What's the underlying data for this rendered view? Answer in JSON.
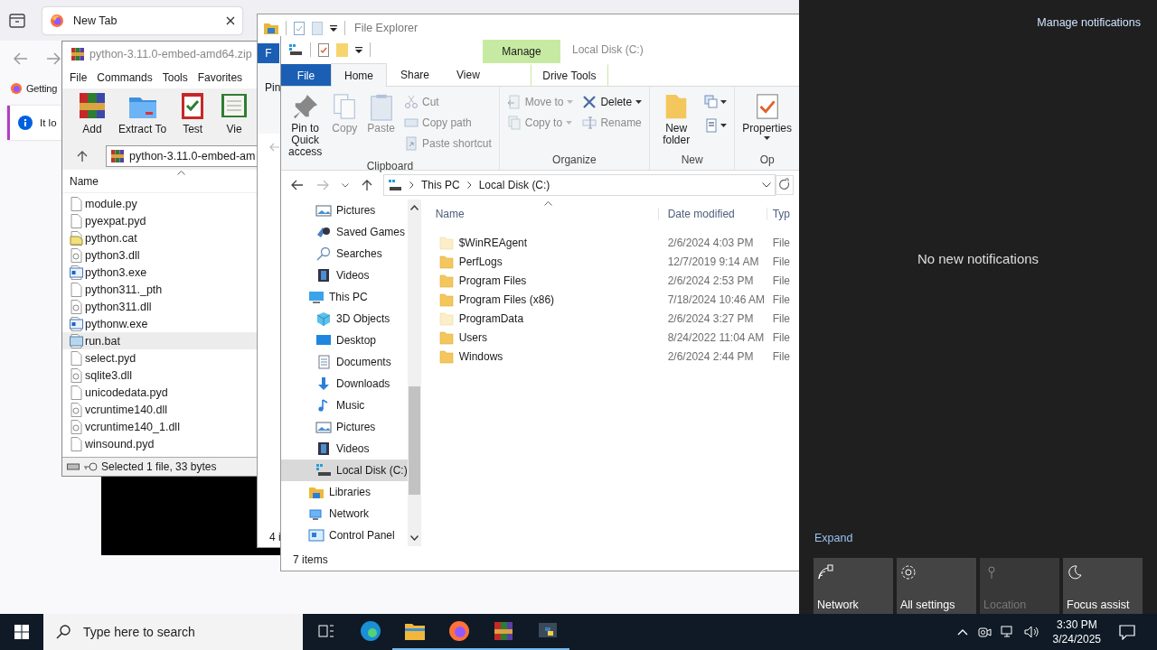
{
  "browser": {
    "tab_title": "New Tab",
    "bookmark": "Getting",
    "notice": "It lo"
  },
  "archiver": {
    "title": "python-3.11.0-embed-amd64.zip",
    "menu": [
      "File",
      "Commands",
      "Tools",
      "Favorites"
    ],
    "tools": [
      {
        "label": "Add",
        "kind": "add"
      },
      {
        "label": "Extract To",
        "kind": "extract"
      },
      {
        "label": "Test",
        "kind": "test"
      },
      {
        "label": "Vie",
        "kind": "view"
      }
    ],
    "path": "python-3.11.0-embed-am",
    "column": "Name",
    "files": [
      {
        "name": "module.py",
        "kind": "blank",
        "selected": false
      },
      {
        "name": "pyexpat.pyd",
        "kind": "blank",
        "selected": false
      },
      {
        "name": "python.cat",
        "kind": "cat",
        "selected": false
      },
      {
        "name": "python3.dll",
        "kind": "dll",
        "selected": false
      },
      {
        "name": "python3.exe",
        "kind": "exe",
        "selected": false
      },
      {
        "name": "python311._pth",
        "kind": "blank",
        "selected": false
      },
      {
        "name": "python311.dll",
        "kind": "dll",
        "selected": false
      },
      {
        "name": "pythonw.exe",
        "kind": "exe",
        "selected": false
      },
      {
        "name": "run.bat",
        "kind": "bat",
        "selected": true
      },
      {
        "name": "select.pyd",
        "kind": "blank",
        "selected": false
      },
      {
        "name": "sqlite3.dll",
        "kind": "dll",
        "selected": false
      },
      {
        "name": "unicodedata.pyd",
        "kind": "blank",
        "selected": false
      },
      {
        "name": "vcruntime140.dll",
        "kind": "dll",
        "selected": false
      },
      {
        "name": "vcruntime140_1.dll",
        "kind": "dll",
        "selected": false
      },
      {
        "name": "winsound.pyd",
        "kind": "blank",
        "selected": false
      }
    ],
    "status": "Selected 1 file, 33 bytes"
  },
  "explorer_back": {
    "title": "File Explorer",
    "tab": "F",
    "command": "Pin",
    "status": "4 i"
  },
  "explorer": {
    "title": "Local Disk (C:)",
    "context_group": "Manage",
    "tabs": [
      {
        "label": "File",
        "kind": "file",
        "selected": false
      },
      {
        "label": "Home",
        "kind": "tab",
        "selected": true
      },
      {
        "label": "Share",
        "kind": "tab",
        "selected": false
      },
      {
        "label": "View",
        "kind": "tab",
        "selected": false
      },
      {
        "label": "Drive Tools",
        "kind": "context",
        "selected": false
      }
    ],
    "groups": [
      {
        "label": "Clipboard",
        "columns": [
          [
            {
              "label": "Pin to Quick access",
              "kind": "large",
              "disabled": false,
              "menu": false
            }
          ],
          [
            {
              "label": "Copy",
              "kind": "large",
              "disabled": true,
              "menu": false
            }
          ],
          [
            {
              "label": "Paste",
              "kind": "large",
              "disabled": true,
              "menu": false
            }
          ],
          [
            {
              "label": "Cut",
              "kind": "small",
              "disabled": true,
              "menu": false
            },
            {
              "label": "Copy path",
              "kind": "small",
              "disabled": true,
              "menu": false
            },
            {
              "label": "Paste shortcut",
              "kind": "small",
              "disabled": true,
              "menu": false
            }
          ]
        ]
      },
      {
        "label": "Organize",
        "columns": [
          [
            {
              "label": "Move to",
              "kind": "small",
              "disabled": true,
              "menu": true
            },
            {
              "label": "Copy to",
              "kind": "small",
              "disabled": true,
              "menu": true
            }
          ],
          [
            {
              "label": "Delete",
              "kind": "small",
              "disabled": false,
              "menu": true
            },
            {
              "label": "Rename",
              "kind": "small",
              "disabled": true,
              "menu": false
            }
          ]
        ]
      },
      {
        "label": "New",
        "columns": [
          [
            {
              "label": "New folder",
              "kind": "large",
              "disabled": false,
              "menu": false
            }
          ],
          [
            {
              "kind": "icon",
              "disabled": false,
              "menu": true
            },
            {
              "kind": "icon",
              "disabled": false,
              "menu": true
            }
          ]
        ]
      },
      {
        "label": "Op",
        "columns": [
          [
            {
              "label": "Properties",
              "kind": "large",
              "disabled": false,
              "menu": true
            }
          ]
        ]
      }
    ],
    "address": [
      "This PC",
      "Local Disk (C:)"
    ],
    "nav": [
      {
        "children": [
          {
            "label": "Pictures",
            "kind": "pictures",
            "selected": false
          },
          {
            "label": "Saved Games",
            "kind": "games",
            "selected": false
          },
          {
            "label": "Searches",
            "kind": "search",
            "selected": false
          },
          {
            "label": "Videos",
            "kind": "videos",
            "selected": false
          }
        ]
      },
      {
        "label": "This PC",
        "kind": "pc",
        "selected": false,
        "children": [
          {
            "label": "3D Objects",
            "kind": "cube",
            "selected": false
          },
          {
            "label": "Desktop",
            "kind": "desktop",
            "selected": false
          },
          {
            "label": "Documents",
            "kind": "documents",
            "selected": false
          },
          {
            "label": "Downloads",
            "kind": "downloads",
            "selected": false
          },
          {
            "label": "Music",
            "kind": "music",
            "selected": false
          },
          {
            "label": "Pictures",
            "kind": "pictures",
            "selected": false
          },
          {
            "label": "Videos",
            "kind": "videos",
            "selected": false
          },
          {
            "label": "Local Disk (C:)",
            "kind": "drive",
            "selected": true
          }
        ]
      },
      {
        "label": "Libraries",
        "kind": "libraries",
        "selected": false
      },
      {
        "label": "Network",
        "kind": "network",
        "selected": false
      },
      {
        "label": "Control Panel",
        "kind": "control",
        "selected": false
      }
    ],
    "columns": [
      "Name",
      "Date modified",
      "Typ"
    ],
    "rows": [
      {
        "name": "$WinREAgent",
        "date": "2/6/2024 4:03 PM",
        "type": "File",
        "hidden": true
      },
      {
        "name": "PerfLogs",
        "date": "12/7/2019 9:14 AM",
        "type": "File",
        "hidden": false
      },
      {
        "name": "Program Files",
        "date": "2/6/2024 2:53 PM",
        "type": "File",
        "hidden": false
      },
      {
        "name": "Program Files (x86)",
        "date": "7/18/2024 10:46 AM",
        "type": "File",
        "hidden": false
      },
      {
        "name": "ProgramData",
        "date": "2/6/2024 3:27 PM",
        "type": "File",
        "hidden": true
      },
      {
        "name": "Users",
        "date": "8/24/2022 11:04 AM",
        "type": "File",
        "hidden": false
      },
      {
        "name": "Windows",
        "date": "2/6/2024 2:44 PM",
        "type": "File",
        "hidden": false
      }
    ],
    "status": "7 items"
  },
  "action_center": {
    "manage": "Manage notifications",
    "empty": "No new notifications",
    "expand": "Expand",
    "tiles": [
      {
        "label": "Network",
        "kind": "network",
        "disabled": false
      },
      {
        "label": "All settings",
        "kind": "settings",
        "disabled": false
      },
      {
        "label": "Location",
        "kind": "location",
        "disabled": true
      },
      {
        "label": "Focus assist",
        "kind": "focus",
        "disabled": false
      }
    ]
  },
  "taskbar": {
    "search": "Type here to search",
    "apps": [
      {
        "kind": "taskview",
        "running": false
      },
      {
        "kind": "edge",
        "running": false
      },
      {
        "kind": "explorer",
        "running": true
      },
      {
        "kind": "firefox",
        "running": true
      },
      {
        "kind": "archiver",
        "running": true
      },
      {
        "kind": "python",
        "running": true
      }
    ],
    "time": "3:30 PM",
    "date": "3/24/2025"
  }
}
